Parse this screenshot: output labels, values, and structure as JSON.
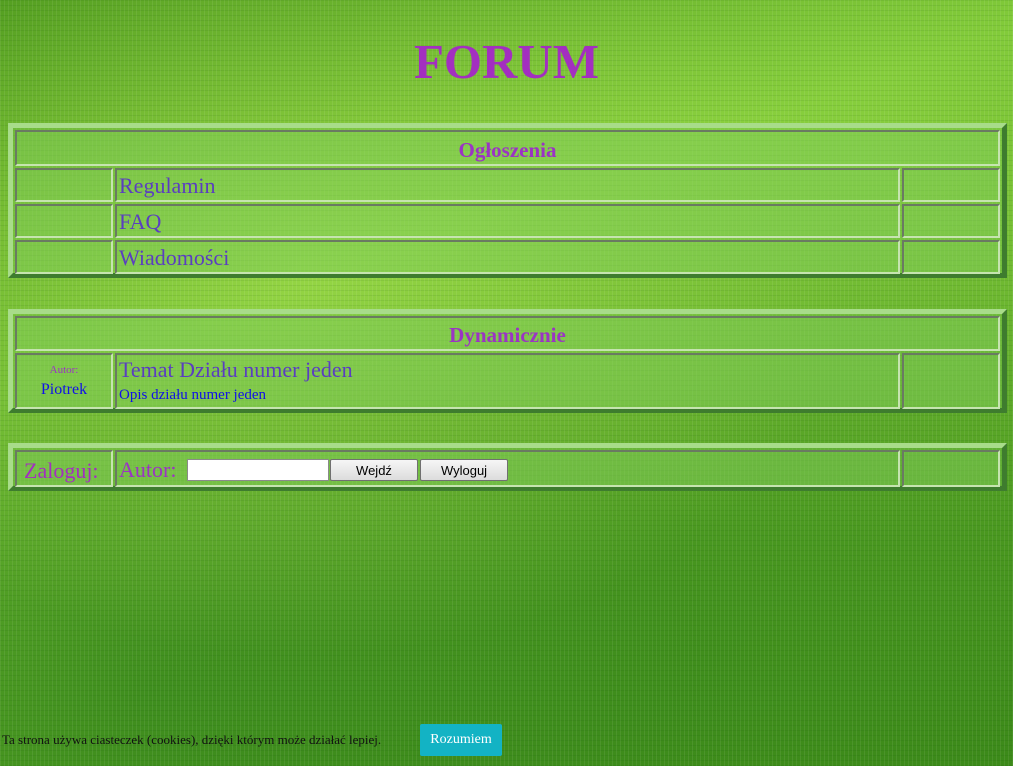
{
  "page": {
    "title": "FORUM"
  },
  "announcements": {
    "header": "Ogłoszenia",
    "items": [
      {
        "label": "Regulamin"
      },
      {
        "label": "FAQ"
      },
      {
        "label": "Wiadomości"
      }
    ]
  },
  "dynamic": {
    "header": "Dynamicznie",
    "topic": {
      "author_label": "Autor:",
      "author_name": "Piotrek",
      "title": "Temat Działu numer jeden",
      "description": "Opis działu numer jeden"
    }
  },
  "login": {
    "label": "Zaloguj:",
    "author_label": "Autor:",
    "author_value": "",
    "enter_button": "Wejdź",
    "logout_button": "Wyloguj"
  },
  "cookie": {
    "text": "Ta strona używa ciasteczek (cookies), dzięki którym może działać lepiej.",
    "accept_button": "Rozumiem"
  },
  "colors": {
    "title": "#a32fc0",
    "link": "#5a3ec0",
    "description": "#1010e8",
    "cookie_button": "#13b3c4"
  }
}
